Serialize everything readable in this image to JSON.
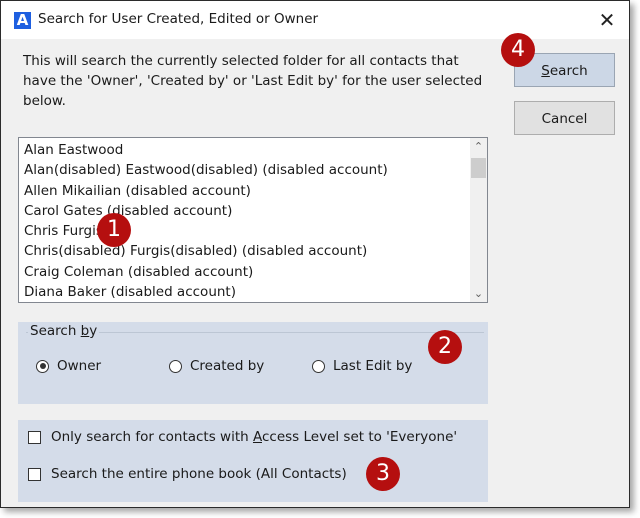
{
  "window": {
    "title": "Search for User Created, Edited or Owner",
    "app_icon": "app-logo-icon",
    "close_label": "✕"
  },
  "description": "This will search the currently selected folder for all contacts that have the 'Owner', 'Created by' or 'Last Edit by' for the user selected below.",
  "buttons": {
    "search": {
      "accel": "S",
      "rest": "earch"
    },
    "cancel": "Cancel"
  },
  "user_list": {
    "items": [
      "Alan Eastwood",
      "Alan(disabled) Eastwood(disabled) (disabled account)",
      "Allen Mikailian (disabled account)",
      "Carol Gates (disabled account)",
      "Chris Furgis",
      "Chris(disabled) Furgis(disabled) (disabled account)",
      "Craig Coleman (disabled account)",
      "Diana Baker (disabled account)"
    ],
    "scroll_up": "⌃",
    "scroll_down": "⌄"
  },
  "search_by": {
    "label_pre": "Search ",
    "label_accel": "b",
    "label_post": "y",
    "options": [
      {
        "label": "Owner",
        "selected": true
      },
      {
        "label": "Created by",
        "selected": false
      },
      {
        "label": "Last Edit by",
        "selected": false
      }
    ]
  },
  "checkboxes": [
    {
      "pre": "Only search for contacts with ",
      "accel": "A",
      "post": "ccess Level set to 'Everyone'",
      "checked": false
    },
    {
      "pre": "Search the entire phone book (All Contacts)",
      "accel": "",
      "post": "",
      "checked": false
    }
  ],
  "annotations": [
    "1",
    "2",
    "3",
    "4"
  ],
  "colors": {
    "badge": "#b50f0f",
    "group_bg": "#d4dce9",
    "primary_button": "#ccd7e6"
  }
}
